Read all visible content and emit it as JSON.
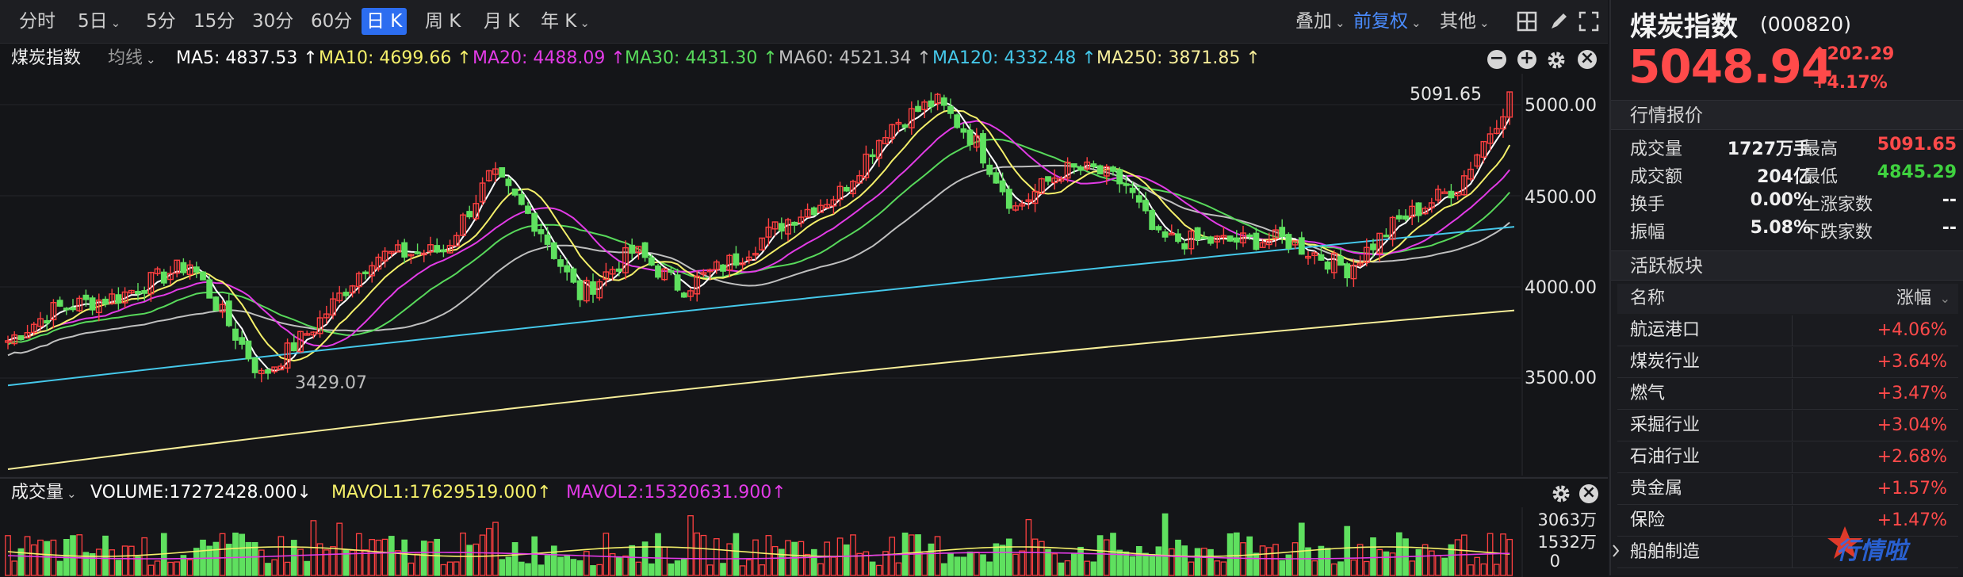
{
  "toolbar": {
    "tabs": [
      {
        "label": "分时",
        "active": false,
        "chev": false
      },
      {
        "label": "5日",
        "active": false,
        "chev": true
      },
      {
        "label": "5分",
        "active": false,
        "chev": false
      },
      {
        "label": "15分",
        "active": false,
        "chev": false
      },
      {
        "label": "30分",
        "active": false,
        "chev": false
      },
      {
        "label": "60分",
        "active": false,
        "chev": false
      },
      {
        "label": "日 K",
        "active": true,
        "chev": false
      },
      {
        "label": "周 K",
        "active": false,
        "chev": false
      },
      {
        "label": "月 K",
        "active": false,
        "chev": false
      },
      {
        "label": "年 K",
        "active": false,
        "chev": true
      }
    ],
    "overlay_label": "叠加",
    "adjust_label": "前复权",
    "other_label": "其他",
    "icons": [
      "grid-layout-icon",
      "draw-pen-icon",
      "fullscreen-icon"
    ]
  },
  "price_panel": {
    "index_name": "煤炭指数",
    "ma_toggle": "均线",
    "ma": [
      {
        "label": "MA5: 4837.53 ↑",
        "color": "#ffffff"
      },
      {
        "label": "MA10: 4699.66 ↑",
        "color": "#f5f06a"
      },
      {
        "label": "MA20: 4488.09 ↑",
        "color": "#e23be6"
      },
      {
        "label": "MA30: 4431.30 ↑",
        "color": "#58d95b"
      },
      {
        "label": "MA60: 4521.34 ↑",
        "color": "#bfbfbf"
      },
      {
        "label": "MA120: 4332.48 ↑",
        "color": "#45c8ea"
      },
      {
        "label": "MA250: 3871.85 ↑",
        "color": "#f7ee9a"
      }
    ],
    "y_axis": [
      "5000.00",
      "4500.00",
      "4000.00",
      "3500.00"
    ],
    "high_marker": "5091.65",
    "low_marker": "3429.07"
  },
  "volume_panel": {
    "label": "成交量",
    "volume": "VOLUME:17272428.000↓",
    "mavol1": "MAVOL1:17629519.000↑",
    "mavol2": "MAVOL2:15320631.900↑",
    "mavol1_color": "#f5f06a",
    "mavol2_color": "#e23be6",
    "y_axis": [
      "3063万",
      "1532万",
      "0"
    ]
  },
  "sidebar": {
    "title": "煤炭指数",
    "code": "(000820)",
    "price": "5048.94",
    "change": "202.29",
    "change_pct": "+4.17%",
    "quote_header": "行情报价",
    "quote": [
      {
        "label": "成交量",
        "value": "1727万手",
        "label2": "最高",
        "value2": "5091.65",
        "color2": "red"
      },
      {
        "label": "成交额",
        "value": "204亿",
        "label2": "最低",
        "value2": "4845.29",
        "color2": "green"
      },
      {
        "label": "换手",
        "value": "0.00%",
        "label2": "上涨家数",
        "value2": "--",
        "color2": "white"
      },
      {
        "label": "振幅",
        "value": "5.08%",
        "label2": "下跌家数",
        "value2": "--",
        "color2": "white"
      }
    ],
    "sector_header": "活跃板块",
    "sector_col_name": "名称",
    "sector_col_chg": "涨幅",
    "sectors": [
      {
        "name": "航运港口",
        "pct": "+4.06%"
      },
      {
        "name": "煤炭行业",
        "pct": "+3.64%"
      },
      {
        "name": "燃气",
        "pct": "+3.47%"
      },
      {
        "name": "采掘行业",
        "pct": "+3.04%"
      },
      {
        "name": "石油行业",
        "pct": "+2.68%"
      },
      {
        "name": "贵金属",
        "pct": "+1.57%"
      },
      {
        "name": "保险",
        "pct": "+1.47%"
      },
      {
        "name": "船舶制造",
        "pct": ""
      }
    ],
    "watermark": "行情啦"
  }
}
